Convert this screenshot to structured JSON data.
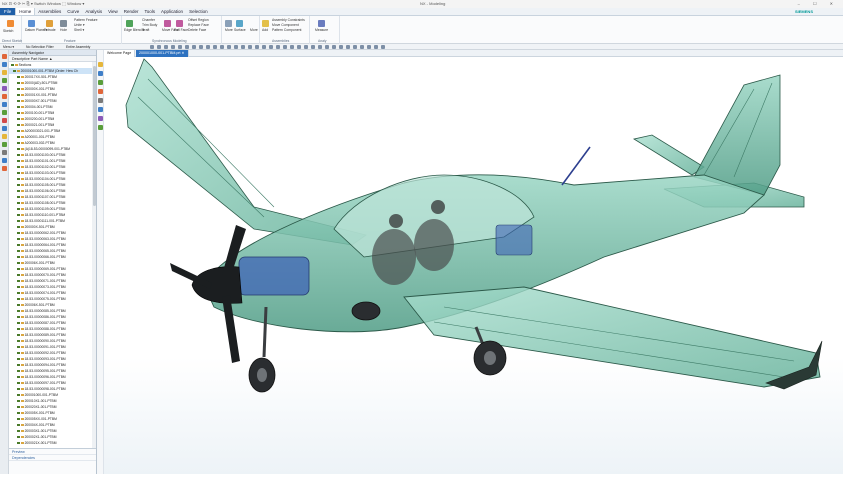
{
  "titlebar": {
    "qat": "NX  ⊡ ⟲ ⟳  ✂  ⎘  ▾  Switch Window  ⬚ Window ▾",
    "title": "NX - Modeling",
    "window_controls": "– ☐ ✕"
  },
  "menu": [
    "File",
    "Home",
    "Assemblies",
    "Curve",
    "Analysis",
    "View",
    "Render",
    "Tools",
    "Application",
    "Selection"
  ],
  "active_menu": "Home",
  "brand": "SIEMENS",
  "ribbon": {
    "sketch": "Sketch",
    "direct_sketch": "Direct Sketch",
    "datum_plane": "Datum Plane ▾",
    "extrude": "Extrude",
    "hole": "Hole",
    "pattern_feature": "Pattern Feature",
    "unite": "Unite ▾",
    "shell": "Shell ▾",
    "feature_label": "Feature",
    "edge_blend": "Edge Blend ▾",
    "chamfer": "Chamfer",
    "trim_body": "Trim Body",
    "draft": "Draft",
    "move_face": "Move Face",
    "pull_face": "Pull Face",
    "offset_region": "Offset Region",
    "replace_face": "Replace Face",
    "delete_face": "Delete Face",
    "sync_label": "Synchronous Modeling",
    "more": "More",
    "surface": "Surface",
    "more2": "More",
    "add": "Add",
    "assembly_constraints": "Assembly Constraints",
    "move_component": "Move Component",
    "pattern_component": "Pattern Component",
    "assemblies_label": "Assemblies",
    "measure": "Measure",
    "analysis_label": "Analy"
  },
  "selection": {
    "menu": "Menu ▾",
    "filter": "No Selection Filter",
    "scope": "Entire Assembly"
  },
  "resource_icon_colors": [
    "#e0663a",
    "#3f7fc8",
    "#e5b63b",
    "#5a9e3b",
    "#8a5ab8",
    "#e0663a",
    "#3f7fc8",
    "#5a9e3b",
    "#d24a4a",
    "#3f7fc8",
    "#e5b63b",
    "#5a9e3b",
    "#7a7a7a",
    "#3f7fc8",
    "#e0663a"
  ],
  "navigator": {
    "title": "Assembly Navigator",
    "column": "Descriptive Part Name ▲",
    "rows": [
      "Sections",
      "200001000-001-PTBM (Order: Hew Ch",
      "200017XX-501-PTBM",
      "20000(AD)-501-PTBM",
      "200000X-001-PTBM",
      "200001XX-001-PTBM",
      "200000X7-001-PTBM",
      "200004-001-PTBM",
      "2000100-001-PTBM",
      "2000200-001-PTBM",
      "2000021-001-PTBM",
      "A200003021-001-PTBM",
      "A200001-001-PTBM",
      "A200003-002-PTBM",
      "(A)18-53-00000099-001-PTBM",
      "18-53-00001100-001-PTBM",
      "18-53-00001101-001-PTBM",
      "18-53-00001102-001-PTBM",
      "18-53-00001103-001-PTBM",
      "18-53-00001104-001-PTBM",
      "18-53-00001105-001-PTBM",
      "18-53-00001106-001-PTBM",
      "18-53-00001107-001-PTBM",
      "18-53-00001108-001-PTBM",
      "18-53-00001109-001-PTBM",
      "18-53-00001110-001-PTBM",
      "18-53-00001111-001-PTBM",
      "200000X-501-PTBM",
      "18-53-00000062-001-PTBM",
      "18-53-00000063-001-PTBM",
      "18-53-00000064-001-PTBM",
      "18-53-00000065-001-PTBM",
      "18-53-00000066-001-PTBM",
      "200006X-001-PTBM",
      "18-53-00000069-001-PTBM",
      "18-53-00000070-001-PTBM",
      "18-53-00000071-001-PTBM",
      "18-53-00000073-001-PTBM",
      "18-53-00000074-001-PTBM",
      "18-53-00000075-001-PTBM",
      "200006X-501-PTBM",
      "18-53-00000085-001-PTBM",
      "18-53-00000086-001-PTBM",
      "18-53-00000087-001-PTBM",
      "18-53-00000088-001-PTBM",
      "18-53-00000089-001-PTBM",
      "18-53-00000090-001-PTBM",
      "18-53-00000091-001-PTBM",
      "18-53-00000092-001-PTBM",
      "18-53-00000093-001-PTBM",
      "18-53-00000094-001-PTBM",
      "18-53-00000095-001-PTBM",
      "18-53-00000096-001-PTBM",
      "18-53-00000097-001-PTBM",
      "18-53-00000098-001-PTBM",
      "200001000-001-PTBM",
      "200010X1-001-PTBM",
      "200020X1-001-PTBM",
      "200005X-001-PTBM",
      "200005XX-001-PTBM",
      "200004X-001-PTBM",
      "200003X1-001-PTBM",
      "200002X1-001-PTBM",
      "2000021X-001-PTBM"
    ],
    "footer": [
      "Preview",
      "Dependencies"
    ]
  },
  "tabs": [
    "Welcome Page",
    "200001000-001-PTBM.prt ✕"
  ],
  "viewport": {
    "fuselage_color": "#6fb8a2",
    "outline_color": "#2c5a4a",
    "spinner_color": "#1b1e20",
    "tire_color": "#2a2d30",
    "engine_color": "#3f64b5"
  }
}
